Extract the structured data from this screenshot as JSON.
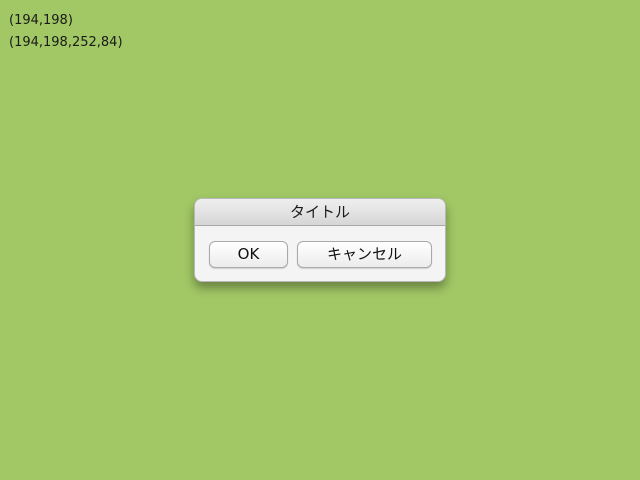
{
  "debug": {
    "point": "(194,198)",
    "rect": "(194,198,252,84)"
  },
  "dialog": {
    "title": "タイトル",
    "ok_label": "OK",
    "cancel_label": "キャンセル"
  },
  "colors": {
    "background": "#a1c865"
  }
}
